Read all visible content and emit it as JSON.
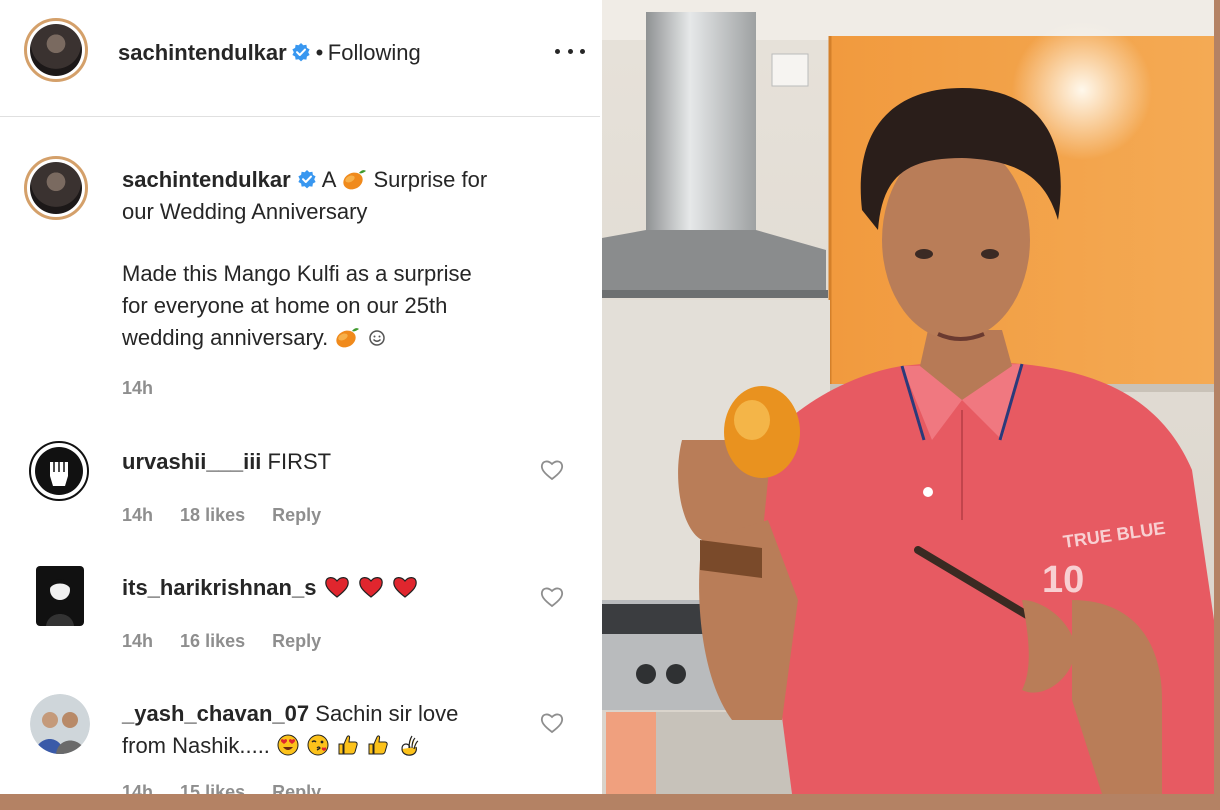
{
  "post": {
    "username": "sachintendulkar",
    "separator": "•",
    "following_label": "Following",
    "caption_prefix": "A",
    "caption_after_mango": "Surprise for",
    "caption_line2": "our Wedding Anniversary",
    "body_line1": "Made this Mango Kulfi as a surprise",
    "body_line2": "for everyone at home on our 25th",
    "body_line3": "wedding anniversary.",
    "time": "14h"
  },
  "comments": [
    {
      "username": "urvashii___iii",
      "text": "FIRST",
      "time": "14h",
      "likes": "18 likes",
      "reply": "Reply"
    },
    {
      "username": "its_harikrishnan_s",
      "text": "",
      "time": "14h",
      "likes": "16 likes",
      "reply": "Reply"
    },
    {
      "username": "_yash_chavan_07",
      "text": "Sachin sir love",
      "text_line2": "from Nashik.....",
      "time": "14h",
      "likes": "15 likes",
      "reply": "Reply"
    }
  ],
  "icons": {
    "verified": "verified-badge-icon",
    "more": "more-options-icon",
    "heart": "heart-outline-icon",
    "mango": "mango-emoji",
    "red_heart": "red-heart-emoji"
  },
  "colors": {
    "verified_blue": "#3897f0",
    "meta_gray": "#8e8e8e",
    "border_brown": "#b48264",
    "story_ring": "#d4a06a"
  }
}
